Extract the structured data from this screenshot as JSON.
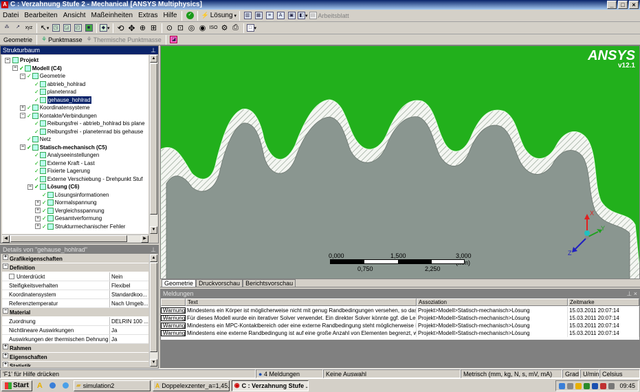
{
  "window": {
    "title": "C : Verzahnung Stufe 2 - Mechanical [ANSYS Multiphysics]"
  },
  "menu": [
    "Datei",
    "Bearbeiten",
    "Ansicht",
    "Maßeinheiten",
    "Extras",
    "Hilfe"
  ],
  "toolbar1": {
    "solve_label": "Lösung",
    "worksheet_label": "Arbeitsblatt"
  },
  "toolbar2": {
    "geometry_label": "Geometrie",
    "point_mass_label": "Punktmasse",
    "thermal_point_mass_label": "Thermische Punktmasse"
  },
  "tree_panel": {
    "title": "Strukturbaum",
    "nodes": [
      {
        "label": "Projekt",
        "level": 0,
        "bold": true
      },
      {
        "label": "Modell (C4)",
        "level": 1,
        "bold": true
      },
      {
        "label": "Geometrie",
        "level": 2
      },
      {
        "label": "abtrieb_hohlrad",
        "level": 3
      },
      {
        "label": "planetenrad",
        "level": 3
      },
      {
        "label": "gehause_hohlrad",
        "level": 3,
        "selected": true
      },
      {
        "label": "Koordinatensysteme",
        "level": 2
      },
      {
        "label": "Kontakte/Verbindungen",
        "level": 2
      },
      {
        "label": "Reibungsfrei - abtrieb_hohlrad bis plane",
        "level": 3
      },
      {
        "label": "Reibungsfrei - planetenrad bis gehause",
        "level": 3
      },
      {
        "label": "Netz",
        "level": 2
      },
      {
        "label": "Statisch-mechanisch (C5)",
        "level": 2,
        "bold": true
      },
      {
        "label": "Analyseeinstellungen",
        "level": 3
      },
      {
        "label": "Externe Kraft - Last",
        "level": 3
      },
      {
        "label": "Fixierte Lagerung",
        "level": 3
      },
      {
        "label": "Externe Verschiebung - Drehpunkt Stuf",
        "level": 3
      },
      {
        "label": "Lösung (C6)",
        "level": 3,
        "bold": true
      },
      {
        "label": "Lösungsinformationen",
        "level": 4
      },
      {
        "label": "Normalspannung",
        "level": 4
      },
      {
        "label": "Vergleichsspannung",
        "level": 4
      },
      {
        "label": "Gesamtverformung",
        "level": 4
      },
      {
        "label": "Strukturmechanischer Fehler",
        "level": 4
      }
    ]
  },
  "details_panel": {
    "title": "Details von \"gehause_hohlrad\"",
    "rows": [
      {
        "type": "cat",
        "label": "Grafikeigenschaften",
        "sign": "+"
      },
      {
        "type": "cat",
        "label": "Definition",
        "sign": "−"
      },
      {
        "type": "check",
        "label": "Unterdrückt",
        "value": "Nein"
      },
      {
        "type": "row",
        "label": "Steifigkeitsverhalten",
        "value": "Flexibel"
      },
      {
        "type": "row",
        "label": "Koordinatensystem",
        "value": "Standardkoo..."
      },
      {
        "type": "row",
        "label": "Referenztemperatur",
        "value": "Nach Umgeb..."
      },
      {
        "type": "cat",
        "label": "Material",
        "sign": "−"
      },
      {
        "type": "row",
        "label": "Zuordnung",
        "value": "DELRIN 100 ..."
      },
      {
        "type": "row",
        "label": "Nichtlineare Auswirkungen",
        "value": "Ja"
      },
      {
        "type": "row",
        "label": "Auswirkungen der thermischen Dehnung",
        "value": "Ja"
      },
      {
        "type": "cat",
        "label": "Rahmen",
        "sign": "+"
      },
      {
        "type": "cat",
        "label": "Eigenschaften",
        "sign": "+"
      },
      {
        "type": "cat",
        "label": "Statistik",
        "sign": "+"
      }
    ]
  },
  "viewport": {
    "logo": "ANSYS",
    "version": "v12.1",
    "scale_top": [
      "0,000",
      "1,500",
      "3,000 (mm)"
    ],
    "scale_bottom": [
      "0,750",
      "2,250"
    ],
    "axes": {
      "x": "X",
      "y": "Y",
      "z": "Z"
    }
  },
  "tabs": [
    "Geometrie",
    "Druckvorschau",
    "Berichtsvorschau"
  ],
  "messages": {
    "title": "Meldungen",
    "headers": [
      "Text",
      "Assoziation",
      "Zeitmarke"
    ],
    "rows": [
      {
        "type": "Warnung",
        "text": "Mindestens ein Körper ist möglicherweise nicht mit genug Randbedingungen versehen, so dass s",
        "assoc": "Projekt>Modell>Statisch-mechanisch>Lösung",
        "time": "15.03.2011 20:07:14"
      },
      {
        "type": "Warnung",
        "text": "Für dieses Modell wurde ein iterativer Solver verwendet.  Ein direkter Solver könnte ggf. die Leis",
        "assoc": "Projekt>Modell>Statisch-mechanisch>Lösung",
        "time": "15.03.2011 20:07:14"
      },
      {
        "type": "Warnung",
        "text": "Mindestens ein MPC-Kontaktbereich oder eine externe Randbedingung steht möglicherweise in K",
        "assoc": "Projekt>Modell>Statisch-mechanisch>Lösung",
        "time": "15.03.2011 20:07:14"
      },
      {
        "type": "Warnung",
        "text": "Mindestens eine externe Randbedingung ist auf eine große Anzahl von Elementen begrenzt, wa",
        "assoc": "Projekt>Modell>Statisch-mechanisch>Lösung",
        "time": "15.03.2011 20:07:14"
      }
    ]
  },
  "status": {
    "help": "'F1' für Hilfe drücken",
    "messages": "4 Meldungen",
    "selection": "Keine Auswahl",
    "units": "Metrisch (mm, kg, N, s, mV, mA)",
    "angle": "Grad",
    "rot": "U/min",
    "temp": "Celsius"
  },
  "taskbar": {
    "start": "Start",
    "items": [
      "simulation2",
      "Doppelexzenter_a=1,45...",
      "C : Verzahnung Stufe ..."
    ],
    "clock": "09:45"
  },
  "colors": {
    "viewport_bg": "#22b01c",
    "part_fill": "#8a9690",
    "titlebar": "#0a246a"
  }
}
